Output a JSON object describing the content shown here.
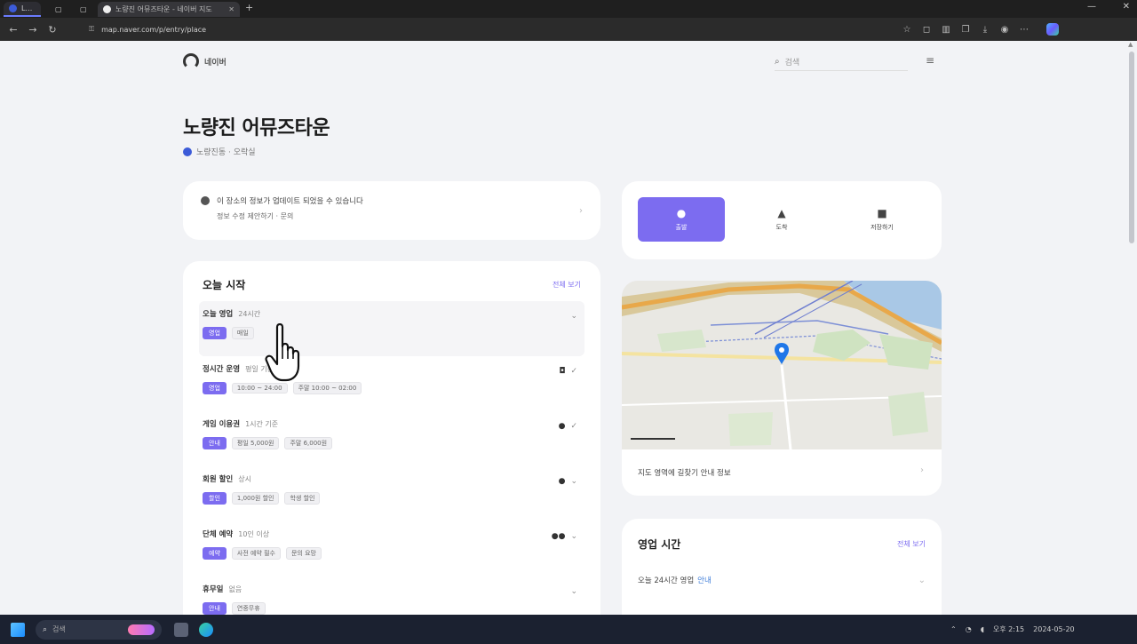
{
  "browser": {
    "tabs": [
      {
        "title": "Lens"
      },
      {
        "title": ""
      },
      {
        "title": ""
      },
      {
        "title": "노량진 어뮤즈타운 - 네이버 지도"
      }
    ],
    "url": "map.naver.com/p/entry/place",
    "new_tab": "+",
    "minimize": "—",
    "close": "✕"
  },
  "header": {
    "logo_text": "네이버",
    "search_placeholder": "검색"
  },
  "place": {
    "title": "노량진 어뮤즈타운",
    "subinfo": "노량진동 · 오락실"
  },
  "notice": {
    "line1": "이 장소의 정보가 업데이트 되었을 수 있습니다",
    "line2": "정보 수정 제안하기 · 문의"
  },
  "modes": [
    {
      "label": "출발",
      "icon": "●"
    },
    {
      "label": "도착",
      "icon": "▲"
    },
    {
      "label": "저장하기",
      "icon": "■"
    }
  ],
  "hours": {
    "title": "오늘 시작",
    "more": "전체 보기",
    "rows": [
      {
        "name": "오늘 영업",
        "sub": "24시간",
        "pill": "영업",
        "tags": [
          "매일"
        ],
        "icons": ""
      },
      {
        "name": "정시간 운영",
        "sub": "평일 기준",
        "pill": "영업",
        "tags": [
          "10:00 ~ 24:00",
          "주말 10:00 ~ 02:00"
        ],
        "icons": "◘"
      },
      {
        "name": "게임 이용권",
        "sub": "1시간 기준",
        "pill": "안내",
        "tags": [
          "평일 5,000원",
          "주말 6,000원"
        ],
        "icons": "●"
      },
      {
        "name": "회원 할인",
        "sub": "상시",
        "pill": "할인",
        "tags": [
          "1,000원 할인",
          "학생 할인"
        ],
        "icons": "●"
      },
      {
        "name": "단체 예약",
        "sub": "10인 이상",
        "pill": "예약",
        "tags": [
          "사전 예약 필수",
          "문의 요망"
        ],
        "icons": "●●"
      },
      {
        "name": "휴무일",
        "sub": "없음",
        "pill": "안내",
        "tags": [
          "연중무휴"
        ],
        "icons": ""
      }
    ]
  },
  "map_footer": "지도 영역에 길찾기 안내 정보",
  "time_card": {
    "title": "영업 시간",
    "more": "전체 보기",
    "row_text": "오늘 24시간 영업",
    "row_link": "안내"
  },
  "taskbar": {
    "search_placeholder": "검색",
    "tray_time": "오후 2:15",
    "tray_date": "2024-05-20"
  }
}
